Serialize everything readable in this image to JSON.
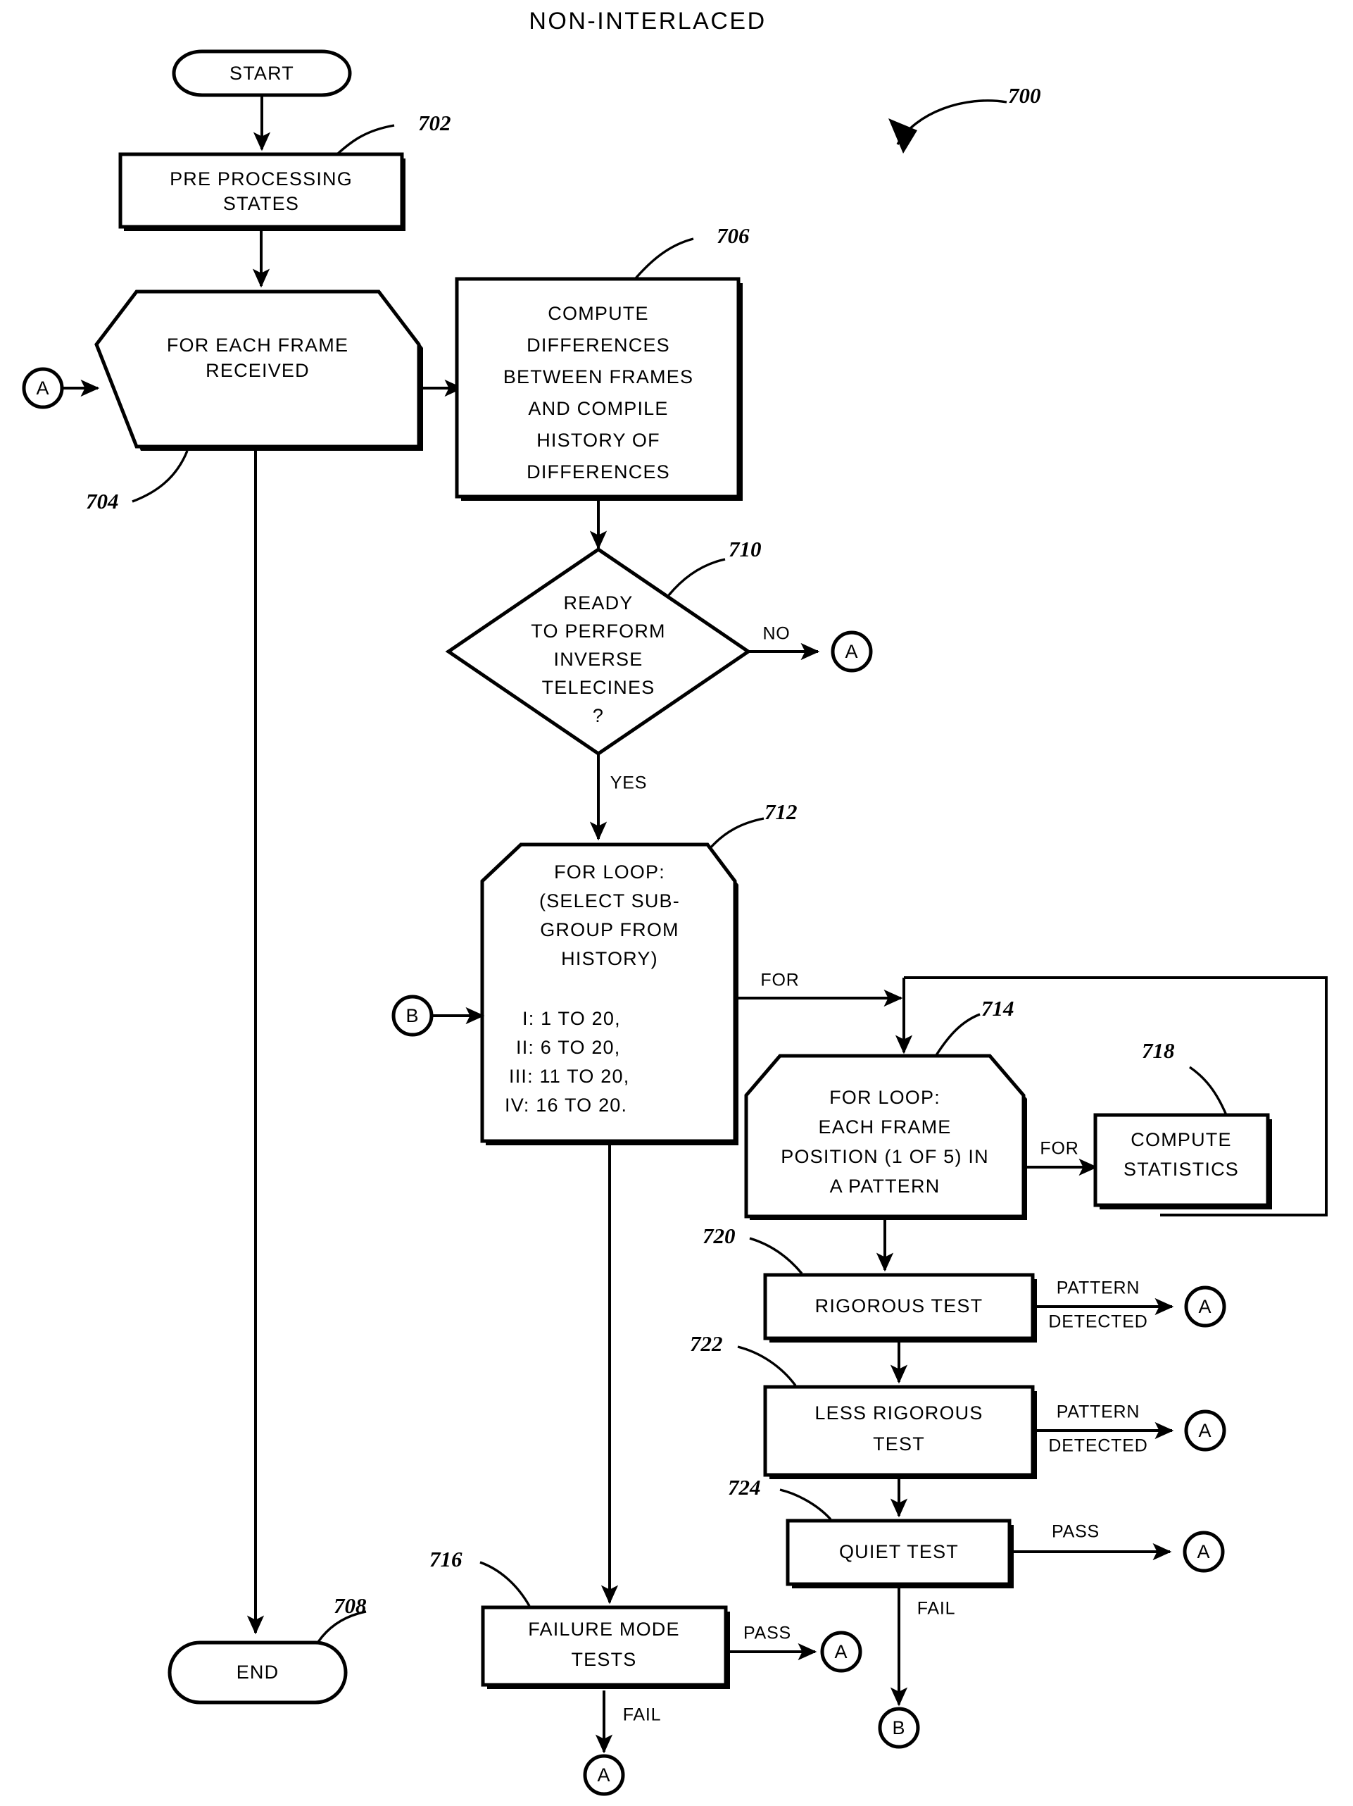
{
  "figure": {
    "title": "NON-INTERLACED",
    "figure_ref": "700"
  },
  "nodes": {
    "start": {
      "ref": "",
      "lines": [
        "START"
      ]
    },
    "pre": {
      "ref": "702",
      "lines": [
        "PRE PROCESSING",
        "STATES"
      ]
    },
    "each_frame": {
      "ref": "704",
      "lines": [
        "FOR EACH FRAME",
        "RECEIVED"
      ]
    },
    "compute_diff": {
      "ref": "706",
      "lines": [
        "COMPUTE",
        "DIFFERENCES",
        "BETWEEN FRAMES",
        "AND COMPILE",
        "HISTORY OF",
        "DIFFERENCES"
      ]
    },
    "end": {
      "ref": "708",
      "lines": [
        "END"
      ]
    },
    "ready": {
      "ref": "710",
      "lines": [
        "READY",
        "TO PERFORM",
        "INVERSE",
        "TELECINES",
        "?"
      ]
    },
    "for_loop_sub": {
      "ref": "712",
      "lines": [
        "FOR LOOP:",
        "(SELECT SUB-",
        "GROUP FROM",
        "HISTORY)"
      ],
      "list": [
        "I:  1 TO 20,",
        "II:  6 TO 20,",
        "III:  11 TO 20,",
        "IV:  16 TO 20."
      ]
    },
    "for_loop_pos": {
      "ref": "714",
      "lines": [
        "FOR LOOP:",
        "EACH FRAME",
        "POSITION (1 OF 5) IN",
        "A PATTERN"
      ]
    },
    "failure_mode": {
      "ref": "716",
      "lines": [
        "FAILURE MODE",
        "TESTS"
      ]
    },
    "compute_stats": {
      "ref": "718",
      "lines": [
        "COMPUTE",
        "STATISTICS"
      ]
    },
    "rigorous": {
      "ref": "720",
      "lines": [
        "RIGOROUS TEST"
      ]
    },
    "less_rigorous": {
      "ref": "722",
      "lines": [
        "LESS RIGOROUS",
        "TEST"
      ]
    },
    "quiet": {
      "ref": "724",
      "lines": [
        "QUIET TEST"
      ]
    }
  },
  "connectors": {
    "a": "A",
    "b": "B"
  },
  "edge_labels": {
    "no": "NO",
    "yes": "YES",
    "for1": "FOR",
    "for2": "FOR",
    "pattern_detected_1_l1": "PATTERN",
    "pattern_detected_1_l2": "DETECTED",
    "pattern_detected_2_l1": "PATTERN",
    "pattern_detected_2_l2": "DETECTED",
    "pass_quiet": "PASS",
    "fail_quiet": "FAIL",
    "pass_failure": "PASS",
    "fail_failure": "FAIL"
  },
  "colors": {
    "ink": "#000000",
    "paper": "#ffffff"
  }
}
